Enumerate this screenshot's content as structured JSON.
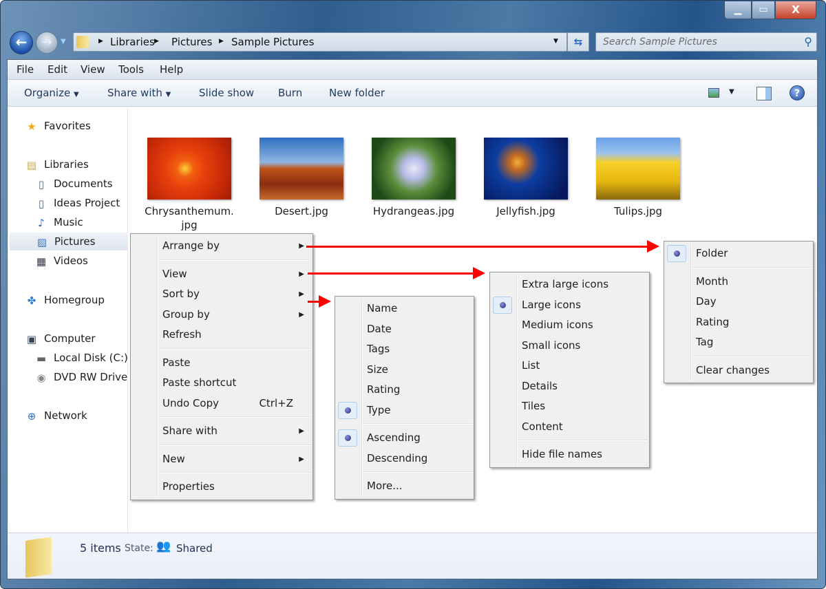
{
  "window": {
    "min_icon": "minimize-icon",
    "max_icon": "maximize-icon",
    "close_label": "X"
  },
  "address": {
    "crumbs": [
      "Libraries",
      "Pictures",
      "Sample Pictures"
    ]
  },
  "search": {
    "placeholder": "Search Sample Pictures"
  },
  "menubar": [
    "File",
    "Edit",
    "View",
    "Tools",
    "Help"
  ],
  "toolbar": {
    "organize": "Organize",
    "share_with": "Share with",
    "slide_show": "Slide show",
    "burn": "Burn",
    "new_folder": "New folder",
    "help": "?"
  },
  "sidebar": {
    "favorites": "Favorites",
    "libraries": "Libraries",
    "documents": "Documents",
    "ideas": "Ideas Project",
    "music": "Music",
    "pictures": "Pictures",
    "videos": "Videos",
    "homegroup": "Homegroup",
    "computer": "Computer",
    "local_disk": "Local Disk (C:)",
    "dvd": "DVD RW Drive",
    "network": "Network"
  },
  "files": [
    "Chrysanthemum.\njpg",
    "Desert.jpg",
    "Hydrangeas.jpg",
    "Jellyfish.jpg",
    "Tulips.jpg"
  ],
  "status": {
    "count": "5 items",
    "state_label": "State:",
    "state_value": "Shared"
  },
  "context_menu": {
    "arrange_by": "Arrange by",
    "view": "View",
    "sort_by": "Sort by",
    "group_by": "Group by",
    "refresh": "Refresh",
    "paste": "Paste",
    "paste_shortcut": "Paste shortcut",
    "undo_copy": "Undo Copy",
    "undo_shortcut": "Ctrl+Z",
    "share_with": "Share with",
    "new": "New",
    "properties": "Properties"
  },
  "sort_menu": {
    "items": [
      "Name",
      "Date",
      "Tags",
      "Size",
      "Rating",
      "Type"
    ],
    "ascending": "Ascending",
    "descending": "Descending",
    "more": "More...",
    "checked": [
      "Type",
      "Ascending"
    ]
  },
  "view_menu": {
    "items": [
      "Extra large icons",
      "Large icons",
      "Medium icons",
      "Small icons",
      "List",
      "Details",
      "Tiles",
      "Content"
    ],
    "hide": "Hide file names",
    "checked": "Large icons"
  },
  "arrange_menu": {
    "folder": "Folder",
    "items": [
      "Month",
      "Day",
      "Rating",
      "Tag"
    ],
    "clear": "Clear changes",
    "checked": "Folder"
  },
  "colors": {
    "annotation_arrow": "#ff0000",
    "menu_bg": "#f0f0f0"
  }
}
